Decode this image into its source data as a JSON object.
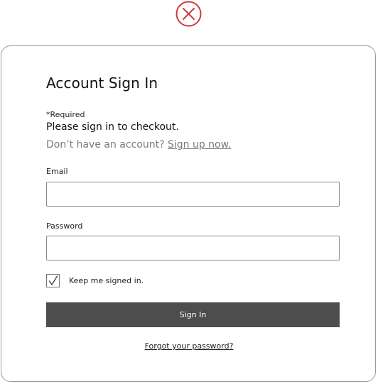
{
  "dialog": {
    "close_icon": "close-icon",
    "title": "Account Sign In",
    "required_note": "*Required",
    "prompt": "Please sign in to checkout.",
    "signup_prefix": "Don’t have an account?",
    "signup_link": "Sign up now."
  },
  "form": {
    "email_label": "Email",
    "email_value": "",
    "password_label": "Password",
    "password_value": "",
    "keep_signed_in_label": "Keep me signed in.",
    "keep_signed_in_checked": true,
    "signin_button": "Sign In",
    "forgot_link": "Forgot your password?"
  },
  "colors": {
    "close_icon": "#d03a3a",
    "button_bg": "#4d4d4d",
    "muted_text": "#7a7a7a",
    "border": "#9a9a9a"
  }
}
